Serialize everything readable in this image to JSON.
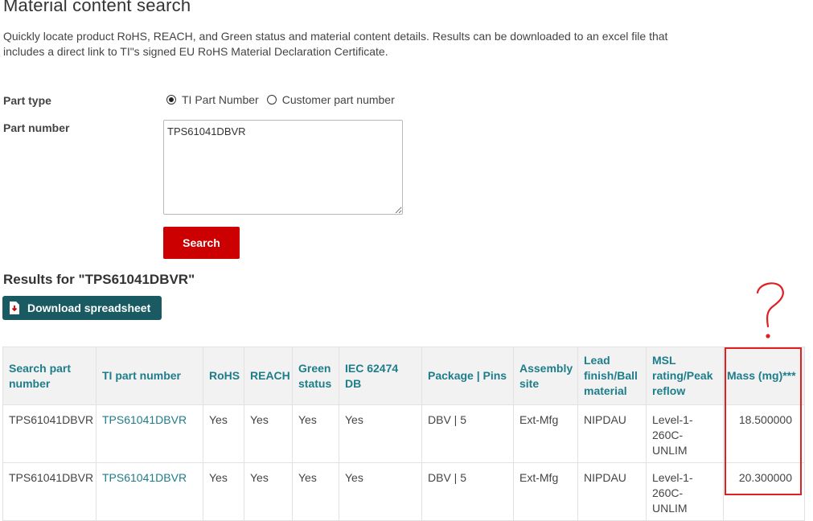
{
  "page": {
    "title": "Material content search",
    "description": "Quickly locate product RoHS, REACH, and Green status and material content details. Results can be downloaded to an excel file that includes a direct link to TI\"s signed EU RoHS Material Declaration Certificate."
  },
  "form": {
    "part_type_label": "Part type",
    "part_type_options": [
      "TI Part Number",
      "Customer part number"
    ],
    "part_type_selected": "TI Part Number",
    "part_number_label": "Part number",
    "part_number_value": "TPS61041DBVR",
    "search_button": "Search"
  },
  "results": {
    "title": "Results for \"TPS61041DBVR\"",
    "download_button": "Download spreadsheet",
    "columns": [
      "Search part number",
      "TI part number",
      "RoHS",
      "REACH",
      "Green status",
      "IEC 62474 DB",
      "Package | Pins",
      "Assembly site",
      "Lead finish/Ball material",
      "MSL rating/Peak reflow",
      "Mass (mg)***"
    ],
    "rows": [
      [
        "TPS61041DBVR",
        "TPS61041DBVR",
        "Yes",
        "Yes",
        "Yes",
        "Yes",
        "DBV | 5",
        "Ext-Mfg",
        "NIPDAU",
        "Level-1-260C-UNLIM",
        "18.500000"
      ],
      [
        "TPS61041DBVR",
        "TPS61041DBVR",
        "Yes",
        "Yes",
        "Yes",
        "Yes",
        "DBV | 5",
        "Ext-Mfg",
        "NIPDAU",
        "Level-1-260C-UNLIM",
        "20.300000"
      ]
    ]
  },
  "annotation": {
    "mark": "?",
    "color": "#e02020"
  },
  "colors": {
    "brand_red": "#cc0000",
    "teal_button": "#195a63",
    "link_teal": "#1e7d8a"
  },
  "icons": {
    "download": "file-download-icon"
  }
}
